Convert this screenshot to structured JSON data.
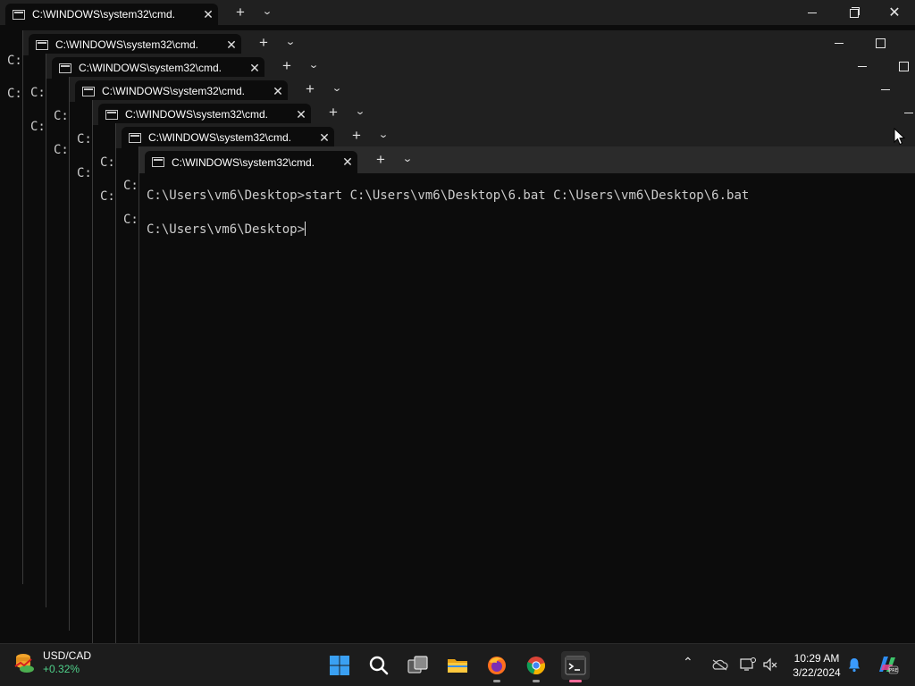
{
  "tab_title": "C:\\WINDOWS\\system32\\cmd.",
  "prompt_peek": "C:",
  "console": {
    "line1": "C:\\Users\\vm6\\Desktop>start C:\\Users\\vm6\\Desktop\\6.bat C:\\Users\\vm6\\Desktop\\6.bat",
    "line2": "C:\\Users\\vm6\\Desktop>"
  },
  "widget": {
    "symbol": "USD/CAD",
    "change": "+0.32%"
  },
  "clock": {
    "time": "10:29 AM",
    "date": "3/22/2024"
  },
  "icons": {
    "taskbar": [
      "windows-start-icon",
      "search-icon",
      "task-view-icon",
      "file-explorer-icon",
      "firefox-icon",
      "chrome-icon",
      "terminal-icon"
    ],
    "tray": [
      "chevron-up-icon",
      "onedrive-icon",
      "network-icon",
      "volume-muted-icon",
      "notification-bell-icon",
      "copilot-icon"
    ]
  },
  "colors": {
    "terminal_bg": "#0c0c0c",
    "titlebar": "#202020",
    "accent_win": "#1e90ff",
    "taskbar": "#1c1c1c"
  }
}
